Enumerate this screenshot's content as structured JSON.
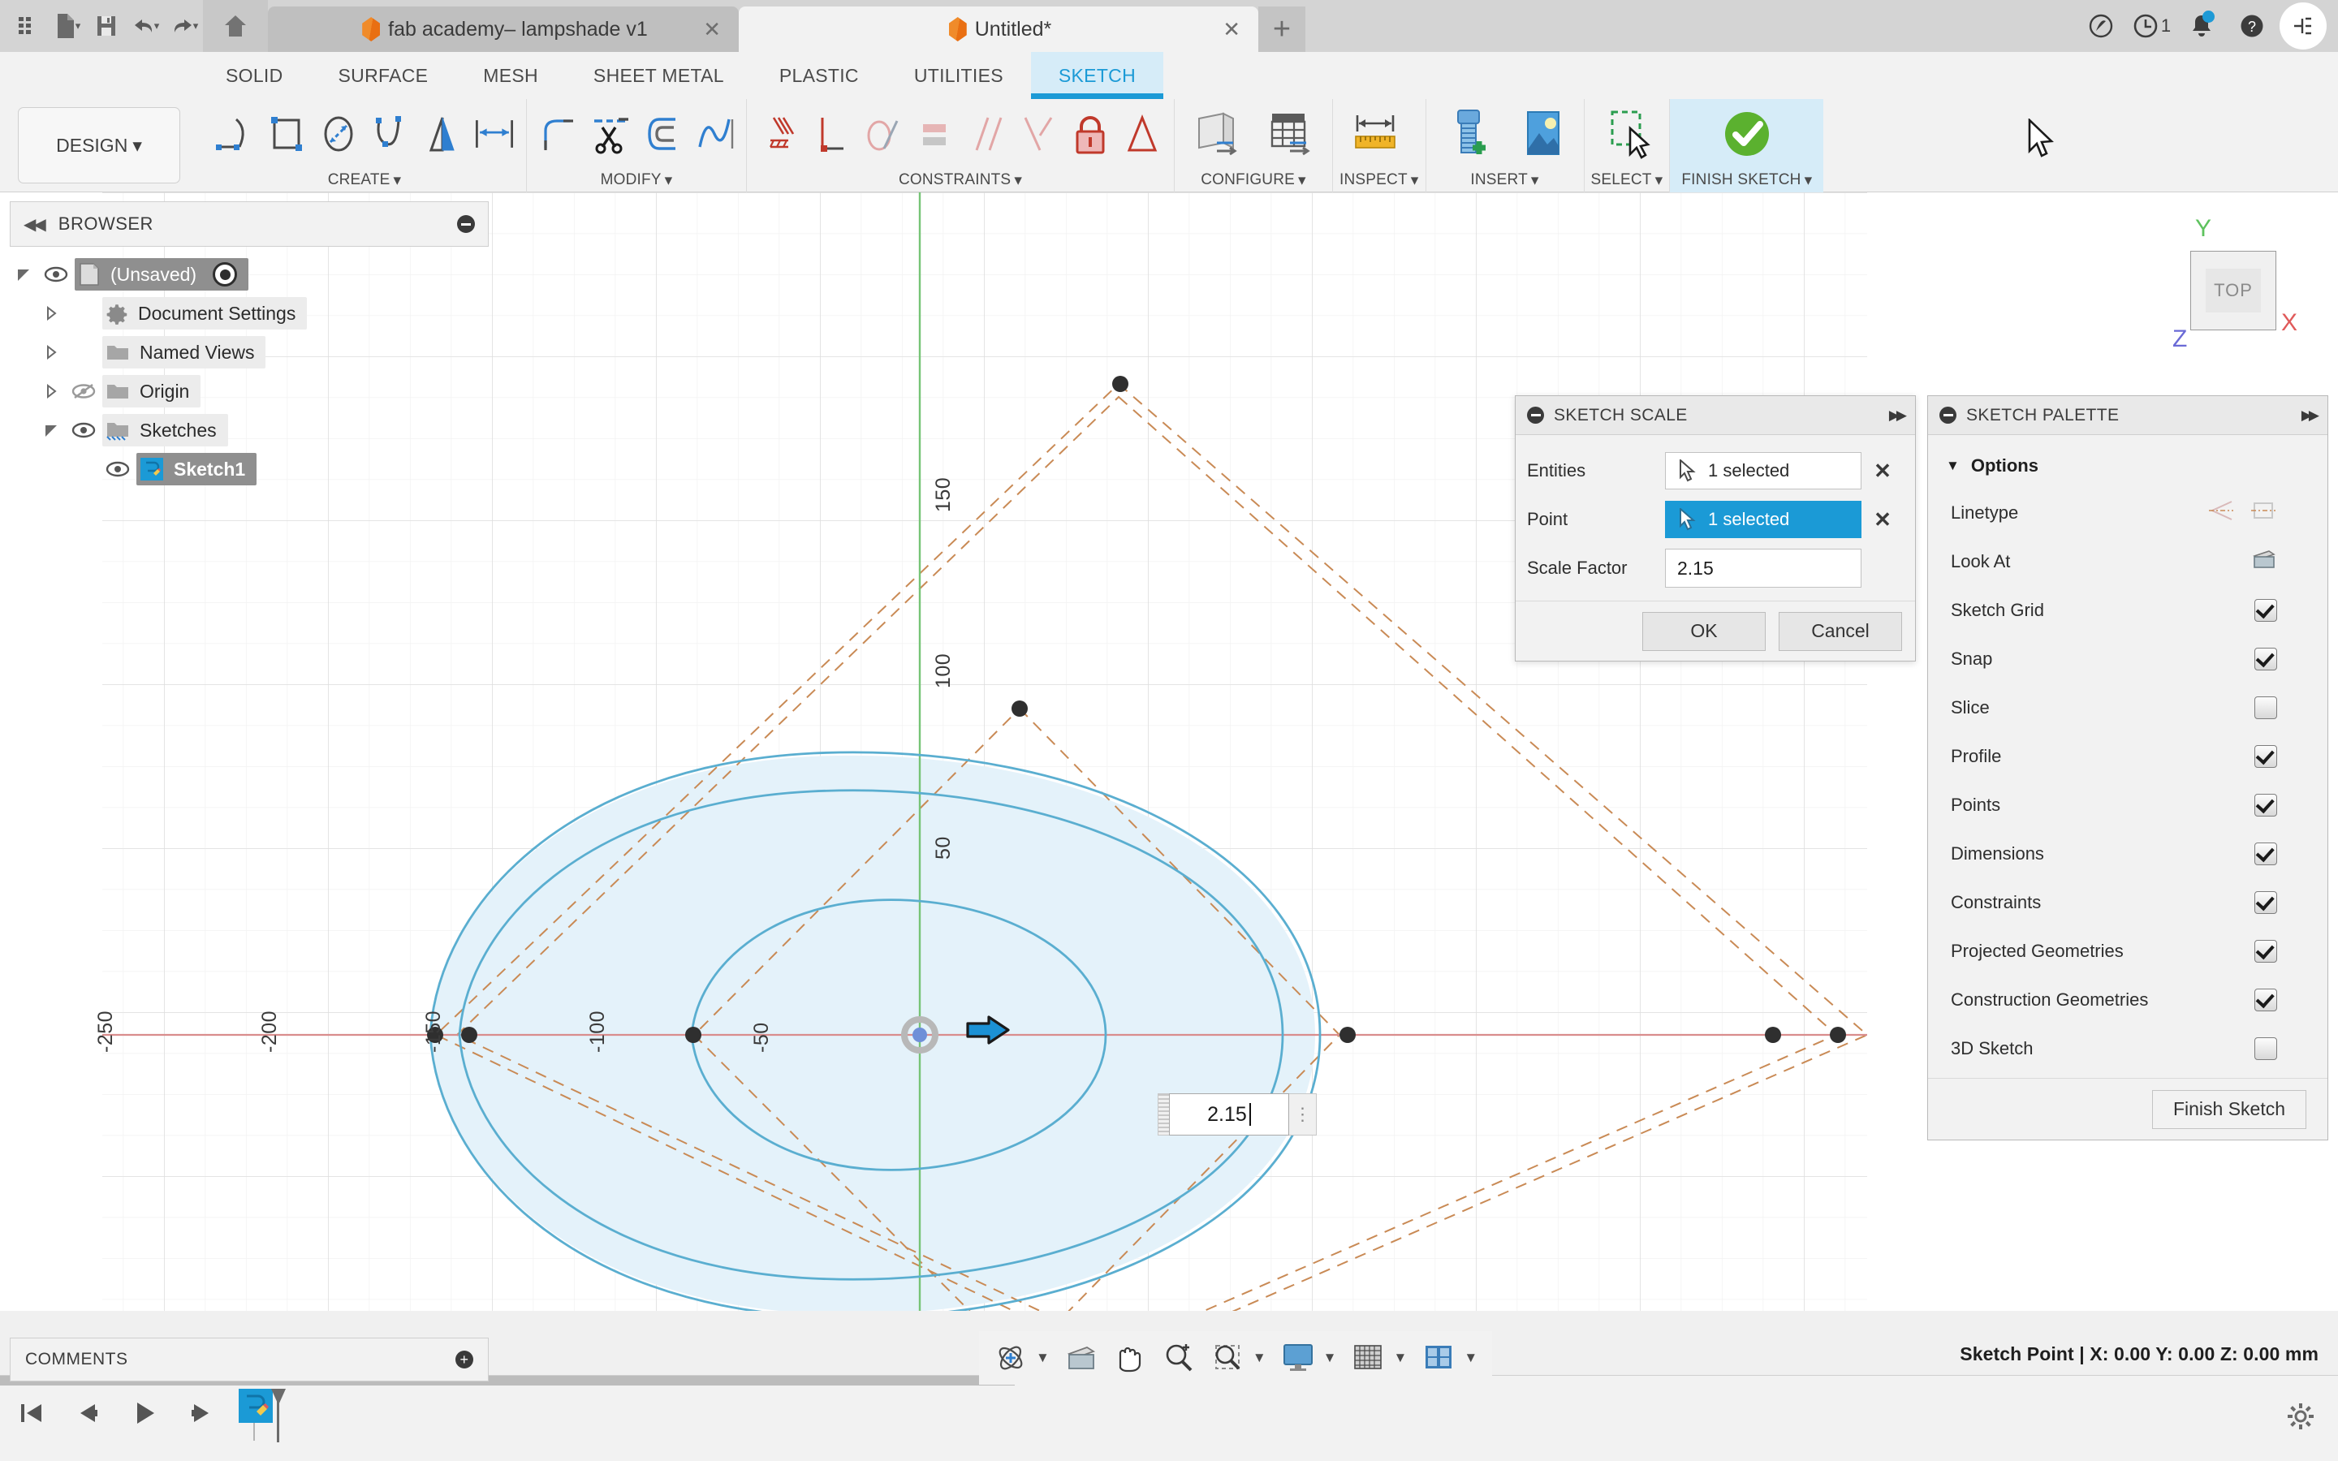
{
  "app": {
    "titlebar": {
      "quick_access": [
        {
          "name": "app-grid-icon",
          "label": "Show Data Panel"
        },
        {
          "name": "file-icon",
          "label": "File"
        },
        {
          "name": "save-icon",
          "label": "Save"
        },
        {
          "name": "undo-icon",
          "label": "Undo"
        },
        {
          "name": "redo-icon",
          "label": "Redo"
        }
      ],
      "home_label": "Home",
      "tabs": [
        {
          "title": "fab academy– lampshade v1",
          "active": false,
          "close": "✕"
        },
        {
          "title": "Untitled*",
          "active": true,
          "close": "✕"
        }
      ],
      "new_tab_label": "+",
      "right_icons": [
        {
          "name": "extensions-icon",
          "label": "Extensions"
        },
        {
          "name": "job-status-icon",
          "label": "Job Status",
          "count": "1"
        },
        {
          "name": "notifications-icon",
          "label": "Notifications"
        },
        {
          "name": "help-icon",
          "label": "Help"
        },
        {
          "name": "account-icon",
          "label": "Account"
        }
      ]
    },
    "ribbon": {
      "design_label": "DESIGN",
      "tabs": [
        {
          "label": "SOLID",
          "active": false
        },
        {
          "label": "SURFACE",
          "active": false
        },
        {
          "label": "MESH",
          "active": false
        },
        {
          "label": "SHEET METAL",
          "active": false
        },
        {
          "label": "PLASTIC",
          "active": false
        },
        {
          "label": "UTILITIES",
          "active": false
        },
        {
          "label": "SKETCH",
          "active": true
        }
      ],
      "panels": [
        {
          "label": "CREATE",
          "tools": [
            "line-icon",
            "rectangle-icon",
            "circle-icon",
            "spline-icon",
            "text-icon",
            "dimension-icon"
          ]
        },
        {
          "label": "MODIFY",
          "tools": [
            "fillet-icon",
            "trim-icon",
            "offset-icon",
            "curvature-icon"
          ]
        },
        {
          "label": "CONSTRAINTS",
          "tools": [
            "coincident-icon",
            "perpendicular-icon",
            "tangent-icon",
            "equal-icon",
            "parallel-icon",
            "symmetry-icon",
            "fix-icon",
            "midpoint-icon"
          ]
        },
        {
          "label": "CONFIGURE",
          "tools": [
            "configure-model-icon",
            "configure-table-icon"
          ]
        },
        {
          "label": "INSPECT",
          "tools": [
            "measure-icon"
          ]
        },
        {
          "label": "INSERT",
          "tools": [
            "insert-mcmaster-icon",
            "insert-image-icon"
          ]
        },
        {
          "label": "SELECT",
          "tools": [
            "select-window-icon"
          ]
        },
        {
          "label": "FINISH SKETCH",
          "tools": [
            "finish-sketch-check-icon"
          ]
        }
      ]
    },
    "browser": {
      "title": "BROWSER",
      "collapse_icon": "◀◀",
      "items": [
        {
          "label": "(Unsaved)",
          "indent": 0,
          "expanded": true,
          "eye": true,
          "selected": true,
          "radio": true,
          "icon": "document-icon"
        },
        {
          "label": "Document Settings",
          "indent": 1,
          "expanded": false,
          "eye": false,
          "selected": false,
          "icon": "gear-icon"
        },
        {
          "label": "Named Views",
          "indent": 1,
          "expanded": false,
          "eye": false,
          "selected": false,
          "icon": "folder-icon"
        },
        {
          "label": "Origin",
          "indent": 1,
          "expanded": false,
          "eye": "off",
          "selected": false,
          "icon": "folder-icon"
        },
        {
          "label": "Sketches",
          "indent": 1,
          "expanded": true,
          "eye": true,
          "selected": false,
          "icon": "folder-sketch-icon"
        },
        {
          "label": "Sketch1",
          "indent": 2,
          "expanded": null,
          "eye": true,
          "selected": true,
          "icon": "sketch-icon"
        }
      ]
    },
    "comments": {
      "title": "COMMENTS",
      "add_label": "+"
    },
    "status": {
      "text": "Sketch Point | X: 0.00 Y: 0.00 Z: 0.00 mm"
    },
    "navbar": {
      "items": [
        {
          "name": "orbit-icon",
          "caret": true
        },
        {
          "name": "look-at-icon",
          "caret": false
        },
        {
          "name": "pan-icon",
          "caret": false
        },
        {
          "name": "zoom-icon",
          "caret": false
        },
        {
          "name": "zoom-window-icon",
          "caret": true
        },
        {
          "name": "display-settings-icon",
          "caret": true
        },
        {
          "name": "grid-snaps-icon",
          "caret": true
        },
        {
          "name": "viewports-icon",
          "caret": true
        }
      ]
    },
    "timeline": {
      "controls": [
        "skip-to-start-icon",
        "step-back-icon",
        "play-icon",
        "step-forward-icon",
        "skip-to-end-icon"
      ],
      "features": [
        {
          "name": "sketch1-timeline-feature",
          "label": "Sketch1"
        }
      ],
      "settings_icon": "timeline-settings-icon"
    }
  },
  "dialogs": {
    "sketch_scale": {
      "title": "SKETCH SCALE",
      "expand_icon": "▶▶",
      "rows": [
        {
          "label": "Entities",
          "value": "1 selected",
          "active": false,
          "clear": "✕"
        },
        {
          "label": "Point",
          "value": "1 selected",
          "active": true,
          "clear": "✕"
        }
      ],
      "scale_factor_label": "Scale Factor",
      "scale_factor_value": "2.15",
      "ok_label": "OK",
      "cancel_label": "Cancel"
    },
    "sketch_palette": {
      "title": "SKETCH PALETTE",
      "expand_icon": "▶▶",
      "section_label": "Options",
      "section_caret": "▼",
      "rows": [
        {
          "label": "Linetype",
          "control": "linetype-buttons",
          "checked": null
        },
        {
          "label": "Look At",
          "control": "look-at-button",
          "checked": null
        },
        {
          "label": "Sketch Grid",
          "control": "checkbox",
          "checked": true
        },
        {
          "label": "Snap",
          "control": "checkbox",
          "checked": true
        },
        {
          "label": "Slice",
          "control": "checkbox",
          "checked": false
        },
        {
          "label": "Profile",
          "control": "checkbox",
          "checked": true
        },
        {
          "label": "Points",
          "control": "checkbox",
          "checked": true
        },
        {
          "label": "Dimensions",
          "control": "checkbox",
          "checked": true
        },
        {
          "label": "Constraints",
          "control": "checkbox",
          "checked": true
        },
        {
          "label": "Projected Geometries",
          "control": "checkbox",
          "checked": true
        },
        {
          "label": "Construction Geometries",
          "control": "checkbox",
          "checked": true
        },
        {
          "label": "3D Sketch",
          "control": "checkbox",
          "checked": false
        }
      ],
      "finish_label": "Finish Sketch"
    }
  },
  "canvas": {
    "inline_value": "2.15",
    "inline_menu_icon": "⋮",
    "viewcube": {
      "face": "TOP",
      "axis_y": "Y",
      "axis_x": "X",
      "axis_z": "Z",
      "color_y": "#5ec25e",
      "color_x": "#e05a5a",
      "color_z": "#6a6ad6"
    },
    "x_axis_ticks": [
      {
        "label": "-250",
        "px": 110
      },
      {
        "label": "-200",
        "px": 312
      },
      {
        "label": "-150",
        "px": 514
      },
      {
        "label": "-100",
        "px": 716
      },
      {
        "label": "-50",
        "px": 918
      }
    ],
    "y_axis_ticks": [
      {
        "label": "150",
        "py": 394
      },
      {
        "label": "100",
        "py": 611
      },
      {
        "label": "50",
        "py": 822
      }
    ],
    "colors": {
      "sketch_curve": "#5aaed0",
      "profile_fill": "#e4f2fa",
      "construction": "#c98a55",
      "x_axis": "#d98d8d",
      "y_axis": "#76c476",
      "grid_minor": "#f0f0f0",
      "grid_major": "#dcdcdc",
      "point": "#3a3a3a",
      "selection_blue": "#1b9ad6"
    }
  }
}
